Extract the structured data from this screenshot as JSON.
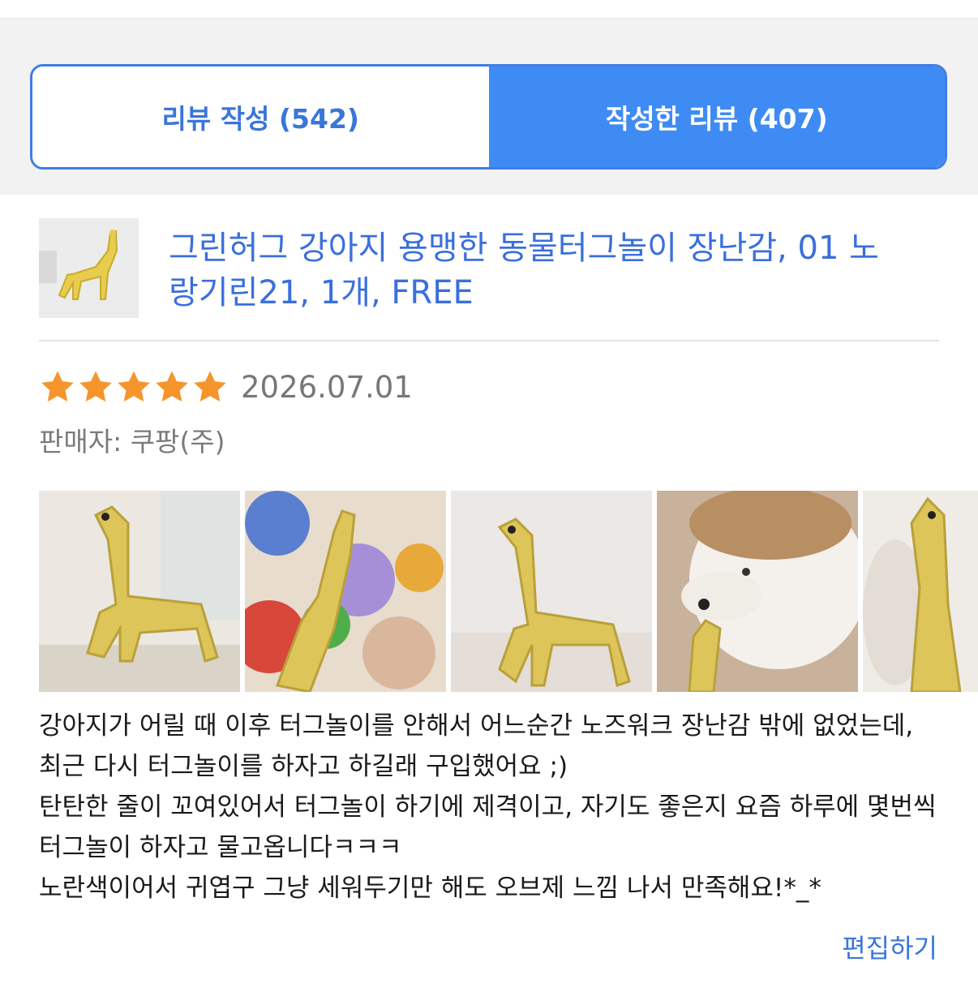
{
  "tabs": [
    {
      "label": "리뷰 작성 (542)",
      "active": false
    },
    {
      "label": "작성한 리뷰 (407)",
      "active": true
    }
  ],
  "product": {
    "title": "그린허그 강아지 용맹한 동물터그놀이 장난감, 01 노랑기린21, 1개, FREE",
    "thumbnail_icon": "giraffe-rope-toy-image"
  },
  "review": {
    "rating": 5,
    "rating_max": 5,
    "date": "2026.07.01",
    "seller": "판매자: 쿠팡(주)",
    "photos": [
      {
        "icon": "giraffe-toy-photo"
      },
      {
        "icon": "giraffe-with-toys-photo"
      },
      {
        "icon": "giraffe-standing-photo"
      },
      {
        "icon": "dog-with-giraffe-photo"
      },
      {
        "icon": "giraffe-closeup-photo"
      }
    ],
    "text": "강아지가 어릴 때 이후 터그놀이를 안해서 어느순간 노즈워크 장난감 밖에 없었는데, 최근 다시 터그놀이를 하자고 하길래 구입했어요 ;)\n탄탄한 줄이 꼬여있어서 터그놀이 하기에 제격이고, 자기도 좋은지 요즘 하루에 몇번씩 터그놀이 하자고 물고옵니다ㅋㅋㅋ\n노란색이어서 귀엽구 그냥 세워두기만 해도 오브제 느낌 나서 만족해요!*_*",
    "edit_label": "편집하기"
  },
  "colors": {
    "accent": "#3f8bf4",
    "link": "#3a6fdc",
    "star": "#f5952c"
  }
}
